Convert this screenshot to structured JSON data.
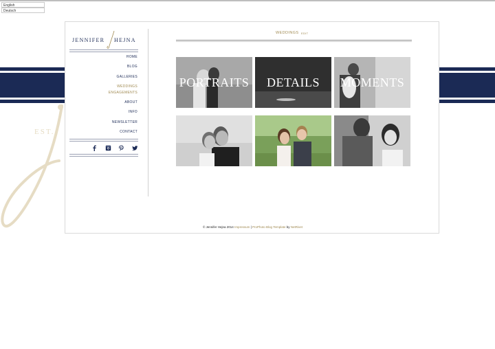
{
  "languages": [
    "English",
    "Deutsch"
  ],
  "brand": {
    "first": "JENNIFER",
    "last": "HEJNA",
    "est": "EST."
  },
  "nav": {
    "items": [
      "HOME",
      "BLOG",
      "GALLERIES"
    ],
    "sub_items": [
      "WEDDINGS",
      "ENGAGEMENTS"
    ],
    "items2": [
      "ABOUT",
      "INFO",
      "NEWSLETTER",
      "CONTACT"
    ]
  },
  "social": [
    "facebook-icon",
    "instagram-icon",
    "pinterest-icon",
    "twitter-icon"
  ],
  "page": {
    "title": "WEDDINGS",
    "edit": "EDIT"
  },
  "tiles": [
    {
      "caption": "PORTRAITS"
    },
    {
      "caption": "DETAILS"
    },
    {
      "caption": "MOMENTS"
    },
    {
      "caption": ""
    },
    {
      "caption": ""
    },
    {
      "caption": ""
    }
  ],
  "footer": {
    "copyright": "© Jennifer Hejna 2014",
    "impressum": "Impressum",
    "sep": "|",
    "template": "ProPhoto Blog Template",
    "by": "by",
    "maker": "NetRivet"
  },
  "colors": {
    "navy": "#1b2a55",
    "gold": "#a08a52",
    "cream": "#e6dcc4"
  }
}
